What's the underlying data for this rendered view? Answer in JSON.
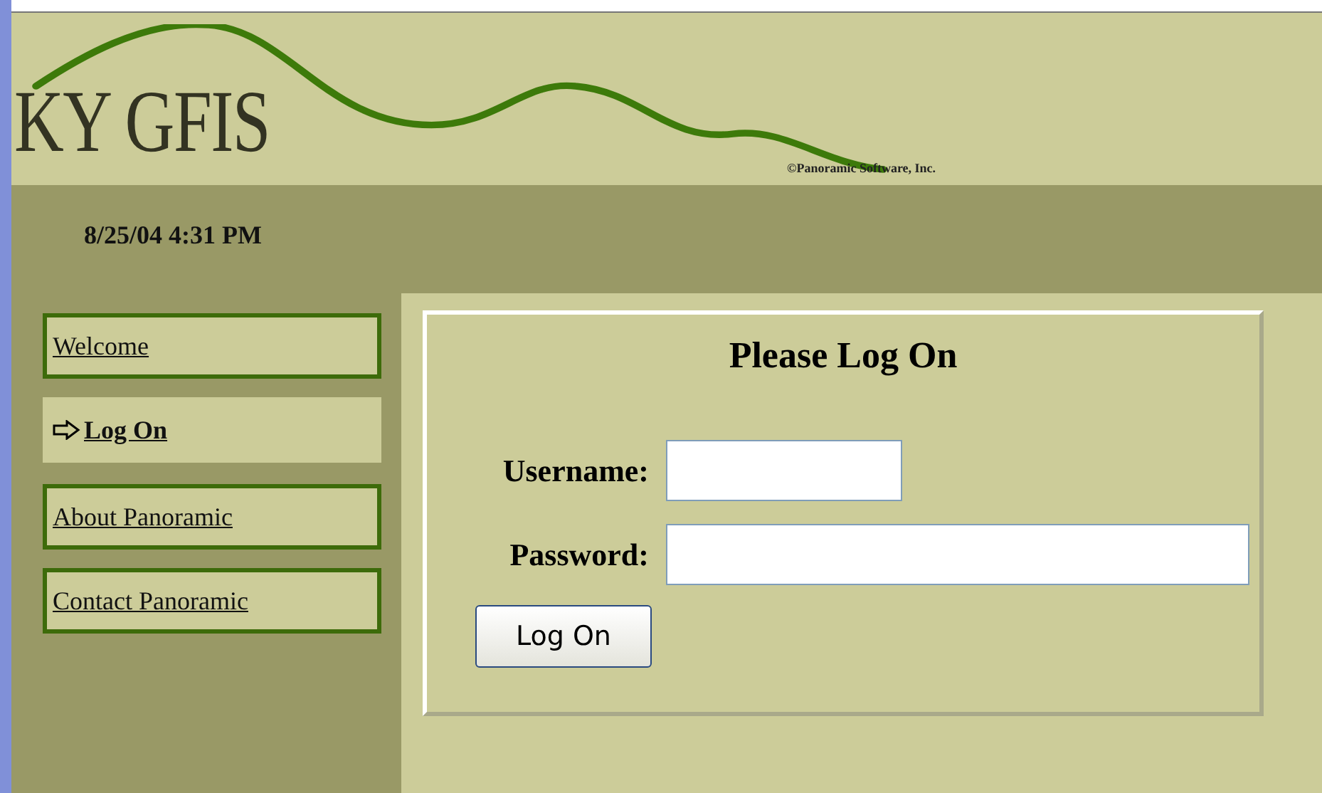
{
  "header": {
    "logo": "KY GFIS",
    "copyright": "©Panoramic Software, Inc."
  },
  "datetime": "8/25/04 4:31 PM",
  "nav": [
    {
      "label": "Welcome",
      "selected": false
    },
    {
      "label": "Log On",
      "selected": true
    },
    {
      "label": "About Panoramic",
      "selected": false
    },
    {
      "label": "Contact Panoramic",
      "selected": false
    }
  ],
  "login": {
    "title": "Please Log On",
    "fields": [
      {
        "label": "Username:",
        "kind": "short"
      },
      {
        "label": "Password:",
        "kind": "long"
      }
    ],
    "button": "Log On"
  }
}
